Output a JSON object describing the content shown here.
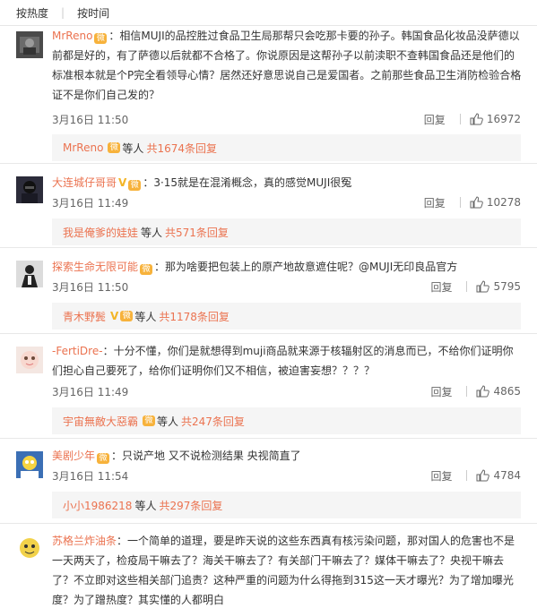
{
  "tabs": {
    "hot": "按热度",
    "time": "按时间"
  },
  "comments": [
    {
      "name": "MrReno",
      "text": "：相信MUJI的品控胜过食品卫生局那帮只会吃那卡要的孙子。韩国食品化妆品没萨德以前都是好的，有了萨德以后就都不合格了。你说原因是这帮孙子以前渎职不查韩国食品还是他们的标准根本就是个P完全看领导心情？居然还好意思说自己是爱国者。之前那些食品卫生消防检验合格证不是你们自己发的？",
      "time": "3月16日 11:50",
      "reply": "回复",
      "likes": "16972",
      "sub_name": "MrReno",
      "sub_mid": "等人",
      "sub_count": "共1674条回复"
    },
    {
      "name": "大连城仔哥哥",
      "text": "：3·15就是在混淆概念，真的感觉MUJI很冤",
      "time": "3月16日 11:49",
      "reply": "回复",
      "likes": "10278",
      "sub_name": "我是俺爹的娃娃",
      "sub_mid": "等人",
      "sub_count": "共571条回复"
    },
    {
      "name": "探索生命无限可能",
      "text": "：那为啥要把包装上的原产地故意遮住呢？@MUJI无印良品官方",
      "time": "3月16日 11:50",
      "reply": "回复",
      "likes": "5795",
      "sub_name": "青木野鬓",
      "sub_mid": "等人",
      "sub_count": "共1178条回复"
    },
    {
      "name": "-FertiDre-",
      "text": "：十分不懂，你们是就想得到muji商品就来源于核辐射区的消息而已，不给你们证明你们担心自己要死了，给你们证明你们又不相信，被迫害妄想？？？？",
      "time": "3月16日 11:49",
      "reply": "回复",
      "likes": "4865",
      "sub_name": "宇宙無敵大惡霸",
      "sub_mid": "等人",
      "sub_count": "共247条回复"
    },
    {
      "name": "美剧少年",
      "text": "：只说产地 又不说检测结果 央视简直了",
      "time": "3月16日 11:54",
      "reply": "回复",
      "likes": "4784",
      "sub_name": "小小1986218",
      "sub_mid": "等人",
      "sub_count": "共297条回复"
    },
    {
      "name": "苏格兰炸油条",
      "text": "：一个简单的道理，要是昨天说的这些东西真有核污染问题，那对国人的危害也不是一天两天了，检疫局干嘛去了？海关干嘛去了？有关部门干嘛去了？媒体干嘛去了？央视干嘛去了？不立即对这些相关部门追责？这种严重的问题为什么得拖到315这一天才曝光？为了增加曝光度？为了蹭热度？其实懂的人都明白"
    }
  ],
  "verify_badge": "V",
  "icons": {
    "like": "thumb-up-icon",
    "badge": "verified-badge-icon"
  },
  "colors": {
    "name": "#eb7350",
    "vip": "#f3b527",
    "bg": "#f2f2f2"
  }
}
